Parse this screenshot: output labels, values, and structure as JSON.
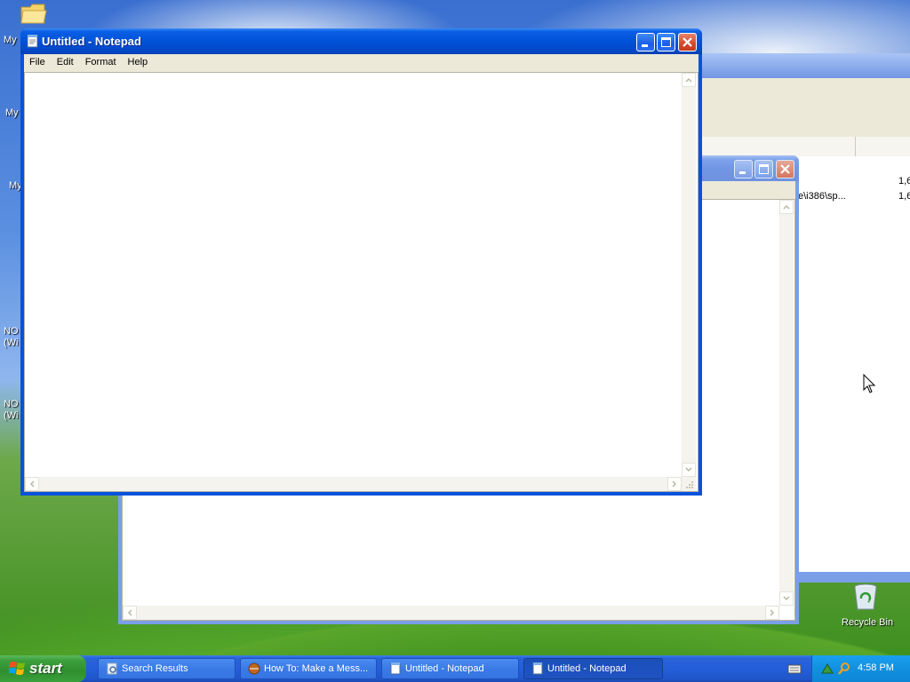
{
  "desktop": {
    "icons": [
      {
        "label": "My"
      },
      {
        "label": "My"
      },
      {
        "label": "My"
      },
      {
        "label": "NO"
      },
      {
        "label": "(Wi"
      },
      {
        "label": "NO"
      },
      {
        "label": "(Wi"
      }
    ],
    "recycle_bin": {
      "label": "Recycle Bin",
      "icon": "recycle-bin-icon"
    }
  },
  "background_window_1": {
    "rows": [
      {
        "path": "",
        "size": "1,6"
      },
      {
        "path": "e\\i386\\sp...",
        "size": "1,6"
      }
    ]
  },
  "notepad": {
    "title": "Untitled - Notepad",
    "menu": [
      "File",
      "Edit",
      "Format",
      "Help"
    ],
    "content": ""
  },
  "taskbar": {
    "start_label": "start",
    "buttons": [
      {
        "label": "Search Results",
        "icon": "search-results-icon"
      },
      {
        "label": "How To: Make a Mess...",
        "icon": "browser-icon"
      },
      {
        "label": "Untitled - Notepad",
        "icon": "notepad-icon"
      },
      {
        "label": "Untitled - Notepad",
        "icon": "notepad-icon"
      }
    ],
    "tray_icons": [
      "network-icon",
      "search-icon"
    ],
    "clock": "4:58 PM"
  },
  "colors": {
    "title_active": "#0052d9",
    "title_inactive": "#7196e4",
    "taskbar": "#245edb",
    "start_green": "#3c9f3c",
    "menubar": "#ece9d8"
  }
}
